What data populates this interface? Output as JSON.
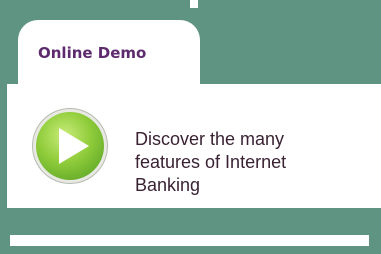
{
  "tab": {
    "label": "Online Demo"
  },
  "promo": {
    "description": "Discover the many features of Internet Banking"
  },
  "icons": {
    "play": "play-icon"
  },
  "colors": {
    "panel_bg": "#5f9483",
    "tab_text": "#5d2a6e",
    "play_green": "#8fcc3a"
  }
}
